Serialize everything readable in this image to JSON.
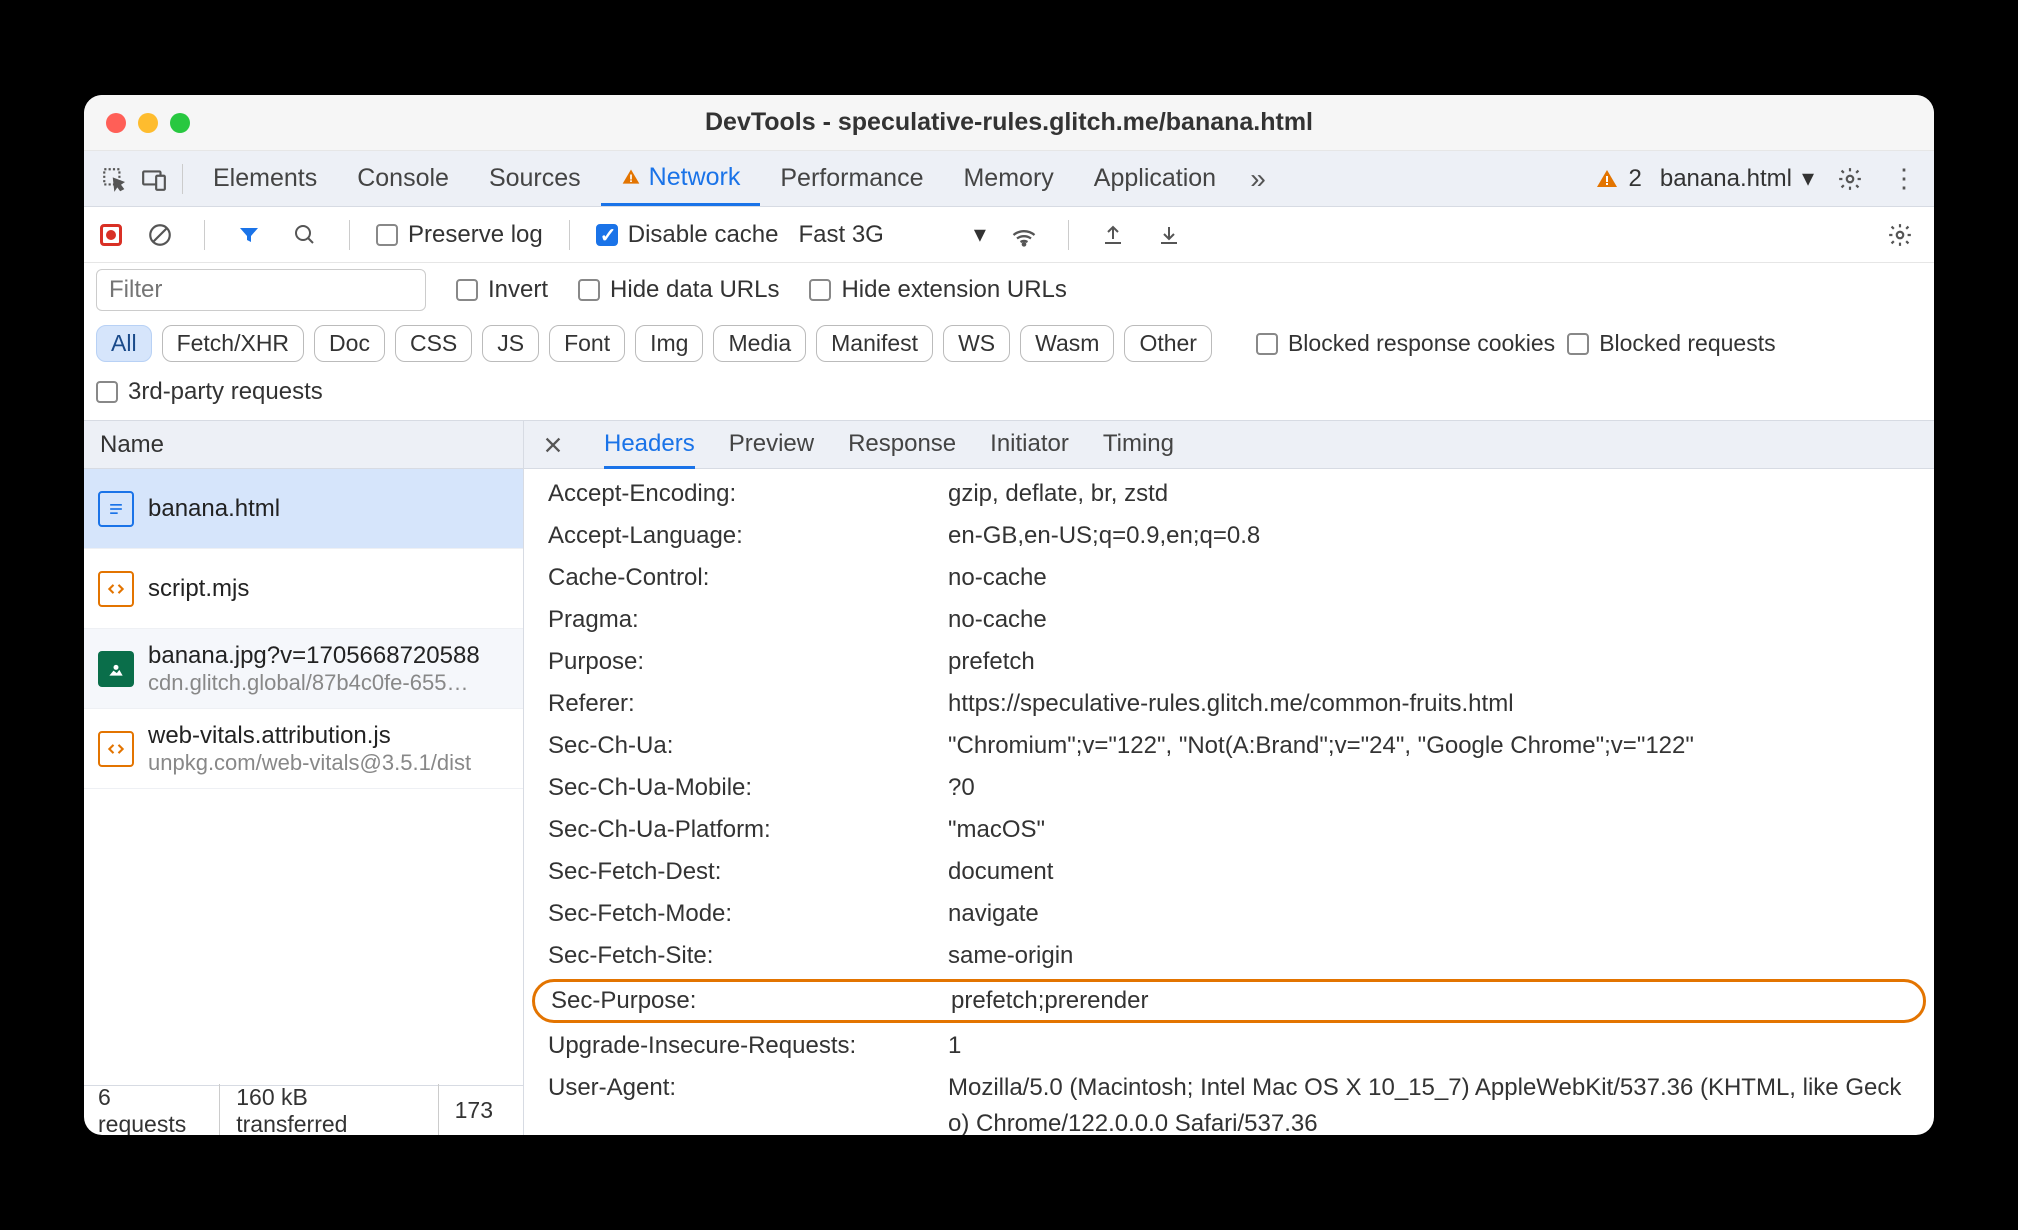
{
  "window": {
    "title": "DevTools - speculative-rules.glitch.me/banana.html"
  },
  "tabs": {
    "items": [
      "Elements",
      "Console",
      "Sources",
      "Network",
      "Performance",
      "Memory",
      "Application"
    ],
    "active": "Network",
    "warning_count": "2",
    "context": "banana.html"
  },
  "toolbar": {
    "preserve_log": "Preserve log",
    "disable_cache": "Disable cache",
    "throttle": "Fast 3G"
  },
  "filters": {
    "placeholder": "Filter",
    "invert": "Invert",
    "hide_data": "Hide data URLs",
    "hide_ext": "Hide extension URLs",
    "types": [
      "All",
      "Fetch/XHR",
      "Doc",
      "CSS",
      "JS",
      "Font",
      "Img",
      "Media",
      "Manifest",
      "WS",
      "Wasm",
      "Other"
    ],
    "blocked_cookies": "Blocked response cookies",
    "blocked_requests": "Blocked requests",
    "third_party": "3rd-party requests"
  },
  "columns": {
    "name": "Name"
  },
  "requests": [
    {
      "name": "banana.html",
      "sub": "",
      "icon": "doc",
      "selected": true
    },
    {
      "name": "script.mjs",
      "sub": "",
      "icon": "js",
      "selected": false
    },
    {
      "name": "banana.jpg?v=1705668720588",
      "sub": "cdn.glitch.global/87b4c0fe-655…",
      "icon": "img",
      "selected": false
    },
    {
      "name": "web-vitals.attribution.js",
      "sub": "unpkg.com/web-vitals@3.5.1/dist",
      "icon": "js",
      "selected": false
    }
  ],
  "status": {
    "count": "6 requests",
    "transferred": "160 kB transferred",
    "resources": "173"
  },
  "detail_tabs": [
    "Headers",
    "Preview",
    "Response",
    "Initiator",
    "Timing"
  ],
  "headers": [
    {
      "k": "Accept-Encoding:",
      "v": "gzip, deflate, br, zstd"
    },
    {
      "k": "Accept-Language:",
      "v": "en-GB,en-US;q=0.9,en;q=0.8"
    },
    {
      "k": "Cache-Control:",
      "v": "no-cache"
    },
    {
      "k": "Pragma:",
      "v": "no-cache"
    },
    {
      "k": "Purpose:",
      "v": "prefetch"
    },
    {
      "k": "Referer:",
      "v": "https://speculative-rules.glitch.me/common-fruits.html"
    },
    {
      "k": "Sec-Ch-Ua:",
      "v": "\"Chromium\";v=\"122\", \"Not(A:Brand\";v=\"24\", \"Google Chrome\";v=\"122\""
    },
    {
      "k": "Sec-Ch-Ua-Mobile:",
      "v": "?0"
    },
    {
      "k": "Sec-Ch-Ua-Platform:",
      "v": "\"macOS\""
    },
    {
      "k": "Sec-Fetch-Dest:",
      "v": "document"
    },
    {
      "k": "Sec-Fetch-Mode:",
      "v": "navigate"
    },
    {
      "k": "Sec-Fetch-Site:",
      "v": "same-origin"
    },
    {
      "k": "Sec-Purpose:",
      "v": "prefetch;prerender",
      "highlight": true
    },
    {
      "k": "Upgrade-Insecure-Requests:",
      "v": "1"
    },
    {
      "k": "User-Agent:",
      "v": "Mozilla/5.0 (Macintosh; Intel Mac OS X 10_15_7) AppleWebKit/537.36 (KHTML, like Gecko) Chrome/122.0.0.0 Safari/537.36"
    }
  ]
}
